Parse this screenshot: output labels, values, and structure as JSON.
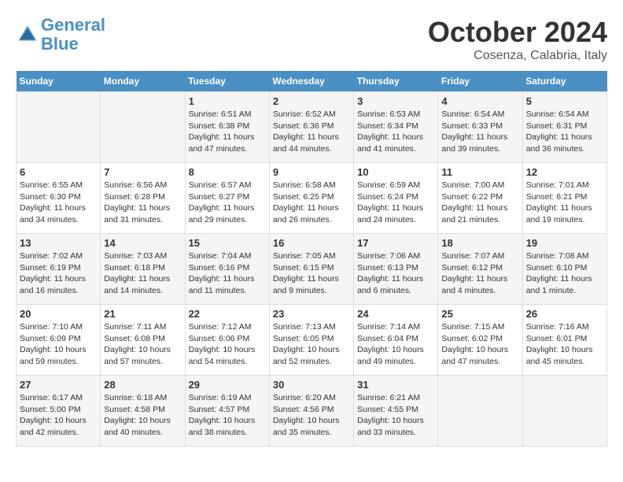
{
  "logo": {
    "line1": "General",
    "line2": "Blue"
  },
  "title": "October 2024",
  "location": "Cosenza, Calabria, Italy",
  "weekdays": [
    "Sunday",
    "Monday",
    "Tuesday",
    "Wednesday",
    "Thursday",
    "Friday",
    "Saturday"
  ],
  "weeks": [
    [
      {
        "day": "",
        "info": ""
      },
      {
        "day": "",
        "info": ""
      },
      {
        "day": "1",
        "info": "Sunrise: 6:51 AM\nSunset: 6:38 PM\nDaylight: 11 hours and 47 minutes."
      },
      {
        "day": "2",
        "info": "Sunrise: 6:52 AM\nSunset: 6:36 PM\nDaylight: 11 hours and 44 minutes."
      },
      {
        "day": "3",
        "info": "Sunrise: 6:53 AM\nSunset: 6:34 PM\nDaylight: 11 hours and 41 minutes."
      },
      {
        "day": "4",
        "info": "Sunrise: 6:54 AM\nSunset: 6:33 PM\nDaylight: 11 hours and 39 minutes."
      },
      {
        "day": "5",
        "info": "Sunrise: 6:54 AM\nSunset: 6:31 PM\nDaylight: 11 hours and 36 minutes."
      }
    ],
    [
      {
        "day": "6",
        "info": "Sunrise: 6:55 AM\nSunset: 6:30 PM\nDaylight: 11 hours and 34 minutes."
      },
      {
        "day": "7",
        "info": "Sunrise: 6:56 AM\nSunset: 6:28 PM\nDaylight: 11 hours and 31 minutes."
      },
      {
        "day": "8",
        "info": "Sunrise: 6:57 AM\nSunset: 6:27 PM\nDaylight: 11 hours and 29 minutes."
      },
      {
        "day": "9",
        "info": "Sunrise: 6:58 AM\nSunset: 6:25 PM\nDaylight: 11 hours and 26 minutes."
      },
      {
        "day": "10",
        "info": "Sunrise: 6:59 AM\nSunset: 6:24 PM\nDaylight: 11 hours and 24 minutes."
      },
      {
        "day": "11",
        "info": "Sunrise: 7:00 AM\nSunset: 6:22 PM\nDaylight: 11 hours and 21 minutes."
      },
      {
        "day": "12",
        "info": "Sunrise: 7:01 AM\nSunset: 6:21 PM\nDaylight: 11 hours and 19 minutes."
      }
    ],
    [
      {
        "day": "13",
        "info": "Sunrise: 7:02 AM\nSunset: 6:19 PM\nDaylight: 11 hours and 16 minutes."
      },
      {
        "day": "14",
        "info": "Sunrise: 7:03 AM\nSunset: 6:18 PM\nDaylight: 11 hours and 14 minutes."
      },
      {
        "day": "15",
        "info": "Sunrise: 7:04 AM\nSunset: 6:16 PM\nDaylight: 11 hours and 11 minutes."
      },
      {
        "day": "16",
        "info": "Sunrise: 7:05 AM\nSunset: 6:15 PM\nDaylight: 11 hours and 9 minutes."
      },
      {
        "day": "17",
        "info": "Sunrise: 7:06 AM\nSunset: 6:13 PM\nDaylight: 11 hours and 6 minutes."
      },
      {
        "day": "18",
        "info": "Sunrise: 7:07 AM\nSunset: 6:12 PM\nDaylight: 11 hours and 4 minutes."
      },
      {
        "day": "19",
        "info": "Sunrise: 7:08 AM\nSunset: 6:10 PM\nDaylight: 11 hours and 1 minute."
      }
    ],
    [
      {
        "day": "20",
        "info": "Sunrise: 7:10 AM\nSunset: 6:09 PM\nDaylight: 10 hours and 59 minutes."
      },
      {
        "day": "21",
        "info": "Sunrise: 7:11 AM\nSunset: 6:08 PM\nDaylight: 10 hours and 57 minutes."
      },
      {
        "day": "22",
        "info": "Sunrise: 7:12 AM\nSunset: 6:06 PM\nDaylight: 10 hours and 54 minutes."
      },
      {
        "day": "23",
        "info": "Sunrise: 7:13 AM\nSunset: 6:05 PM\nDaylight: 10 hours and 52 minutes."
      },
      {
        "day": "24",
        "info": "Sunrise: 7:14 AM\nSunset: 6:04 PM\nDaylight: 10 hours and 49 minutes."
      },
      {
        "day": "25",
        "info": "Sunrise: 7:15 AM\nSunset: 6:02 PM\nDaylight: 10 hours and 47 minutes."
      },
      {
        "day": "26",
        "info": "Sunrise: 7:16 AM\nSunset: 6:01 PM\nDaylight: 10 hours and 45 minutes."
      }
    ],
    [
      {
        "day": "27",
        "info": "Sunrise: 6:17 AM\nSunset: 5:00 PM\nDaylight: 10 hours and 42 minutes."
      },
      {
        "day": "28",
        "info": "Sunrise: 6:18 AM\nSunset: 4:58 PM\nDaylight: 10 hours and 40 minutes."
      },
      {
        "day": "29",
        "info": "Sunrise: 6:19 AM\nSunset: 4:57 PM\nDaylight: 10 hours and 38 minutes."
      },
      {
        "day": "30",
        "info": "Sunrise: 6:20 AM\nSunset: 4:56 PM\nDaylight: 10 hours and 35 minutes."
      },
      {
        "day": "31",
        "info": "Sunrise: 6:21 AM\nSunset: 4:55 PM\nDaylight: 10 hours and 33 minutes."
      },
      {
        "day": "",
        "info": ""
      },
      {
        "day": "",
        "info": ""
      }
    ]
  ]
}
